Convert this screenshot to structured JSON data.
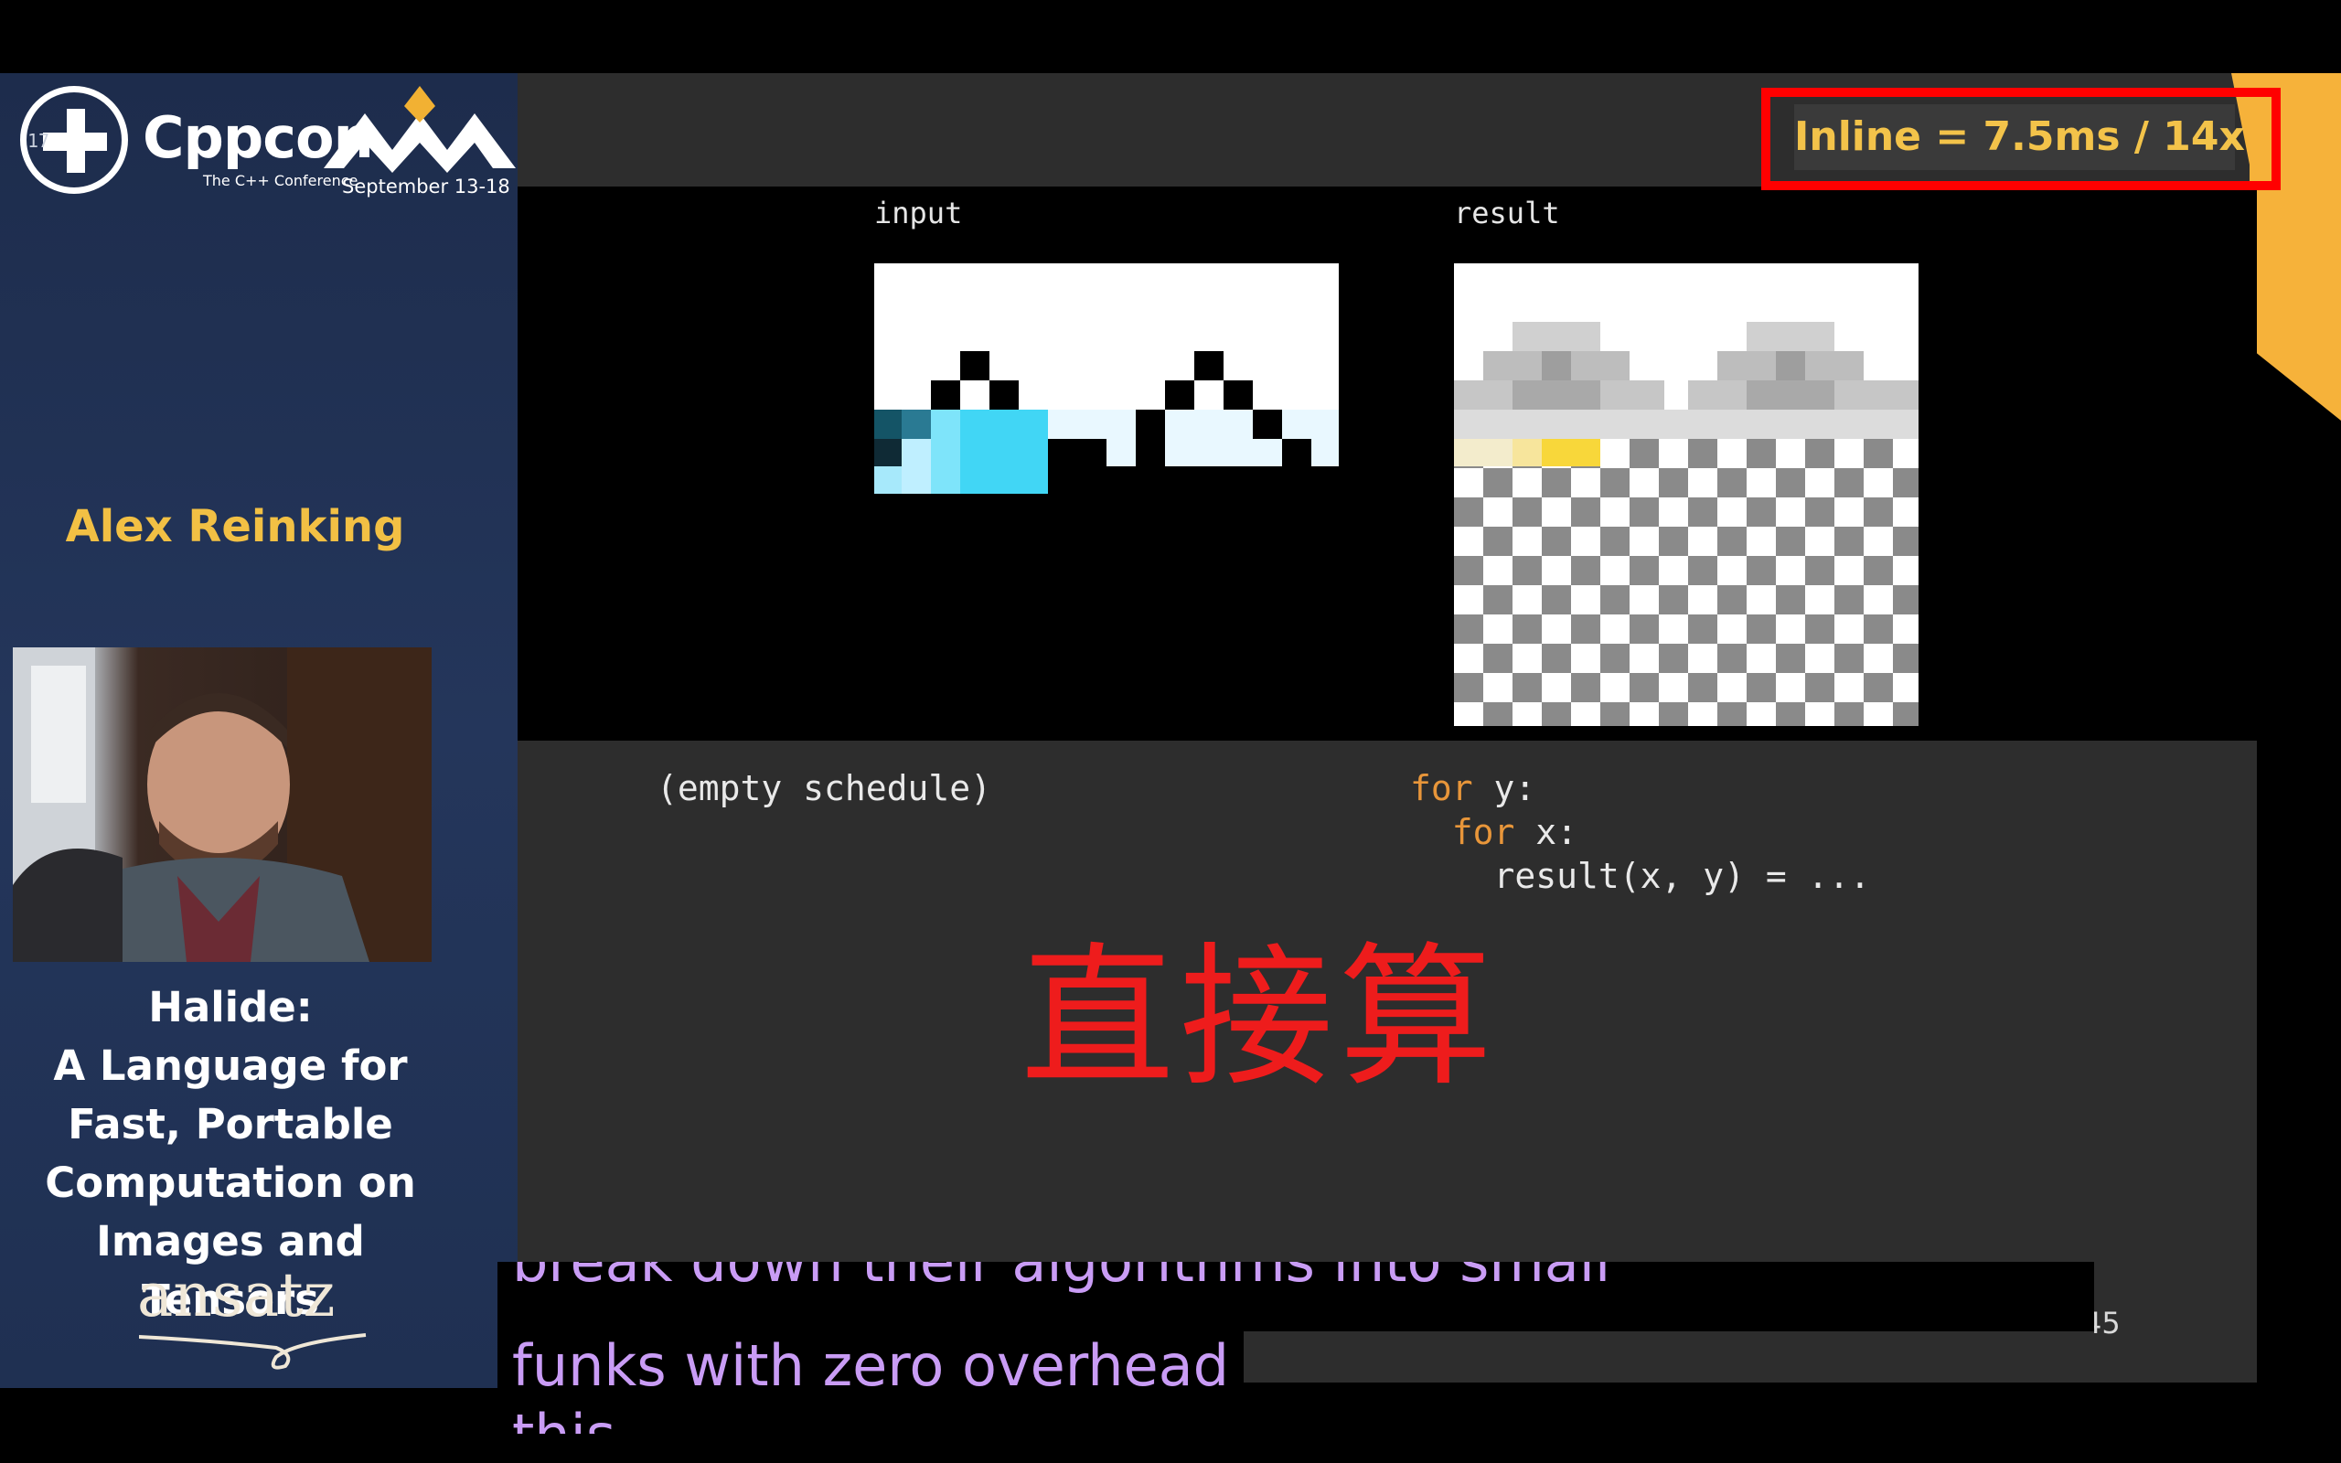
{
  "conference": {
    "logo_counter": "17",
    "name": "Cppcon",
    "tagline": "The C++ Conference",
    "dates": "September 13-18"
  },
  "speaker": {
    "name": "Alex Reinking"
  },
  "talk": {
    "title_lines": [
      "Halide:",
      "A Language for",
      "Fast, Portable",
      "Computation on",
      "Images and",
      "Tensors"
    ]
  },
  "sponsor": {
    "name": "ansatz"
  },
  "slide": {
    "badge_text": "Inline = 7.5ms / 14x",
    "input_label": "input",
    "result_label": "result",
    "empty_schedule": "(empty schedule)",
    "code": {
      "line1_kw": "for",
      "line1_rest": " y:",
      "line2_kw": "for",
      "line2_rest": " x:",
      "line3": "result(x, y) = ..."
    },
    "overlay_text": "直接算",
    "page_number": "45",
    "colors": {
      "keyword": "#e8963a",
      "overlay": "#ee1c1c",
      "badge_text": "#f3c34a",
      "highlight_box": "#ff0000"
    }
  },
  "captions": {
    "line1": "break down their algorithms into small",
    "line2": "funks with zero overhead",
    "line3": "this",
    "color": "#c99cf5"
  },
  "icons": [
    "cppcon-plus-icon",
    "mountains-logo-icon",
    "ansatz-swash-icon"
  ]
}
